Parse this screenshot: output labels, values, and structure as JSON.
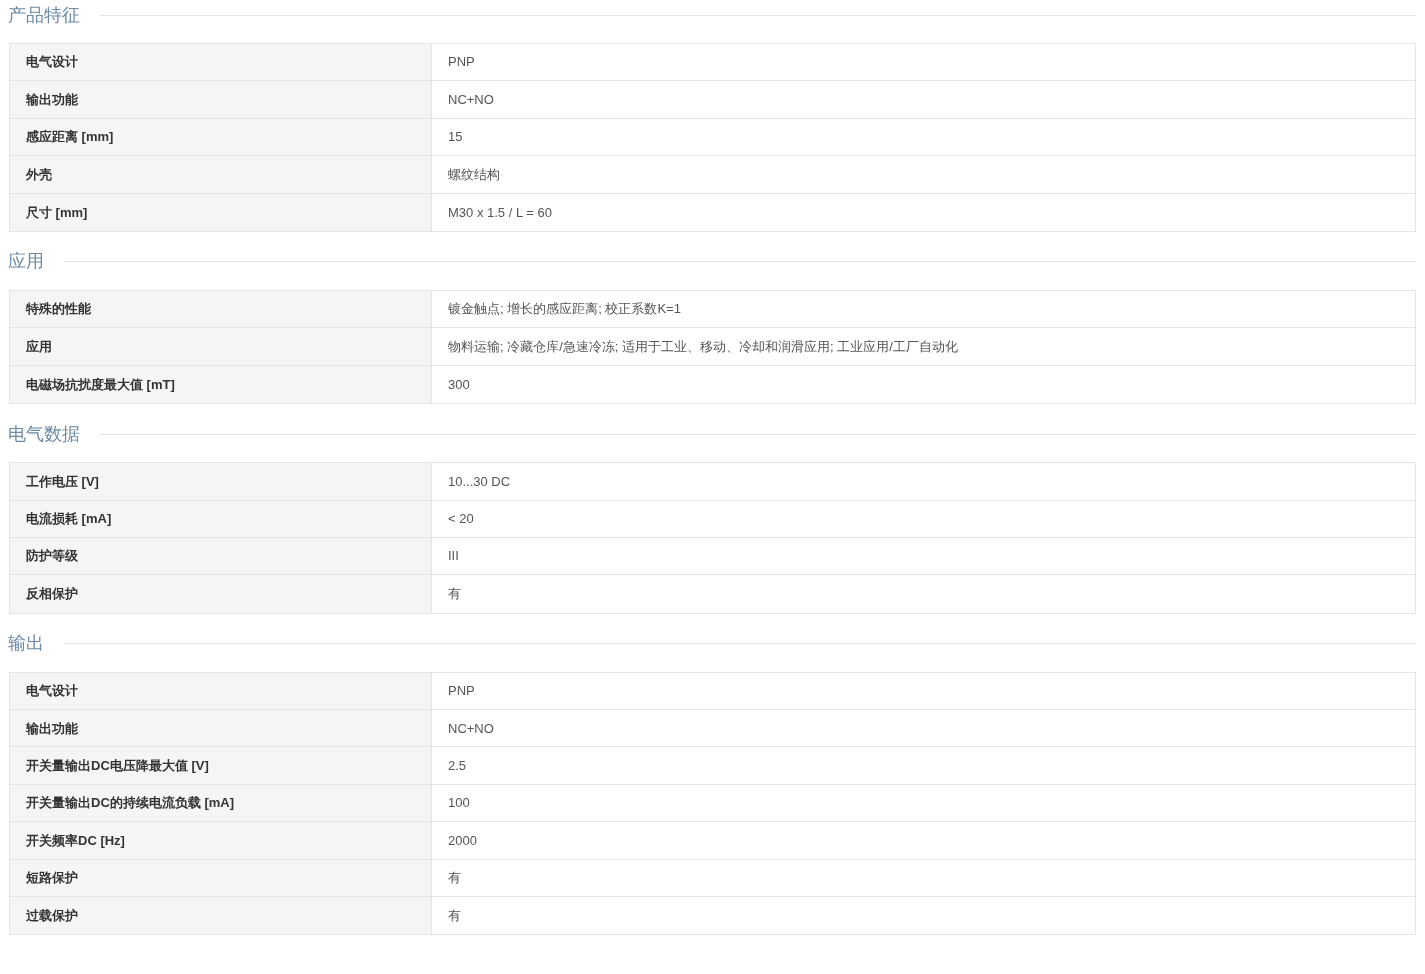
{
  "sections": [
    {
      "title": "产品特征",
      "rows": [
        {
          "label": "电气设计",
          "value": "PNP"
        },
        {
          "label": "输出功能",
          "value": "NC+NO"
        },
        {
          "label": "感应距离 [mm]",
          "value": "15"
        },
        {
          "label": "外壳",
          "value": "螺纹结构"
        },
        {
          "label": "尺寸 [mm]",
          "value": "M30 x 1.5 / L = 60"
        }
      ]
    },
    {
      "title": "应用",
      "rows": [
        {
          "label": "特殊的性能",
          "value": "镀金触点; 增长的感应距离; 校正系数K=1"
        },
        {
          "label": "应用",
          "value": "物料运输; 冷藏仓库/急速冷冻; 适用于工业、移动、冷却和润滑应用; 工业应用/工厂自动化"
        },
        {
          "label": "电磁场抗扰度最大值 [mT]",
          "value": "300"
        }
      ]
    },
    {
      "title": "电气数据",
      "rows": [
        {
          "label": "工作电压 [V]",
          "value": "10...30 DC"
        },
        {
          "label": "电流损耗 [mA]",
          "value": "< 20"
        },
        {
          "label": "防护等级",
          "value": "III"
        },
        {
          "label": "反相保护",
          "value": "有"
        }
      ]
    },
    {
      "title": "输出",
      "rows": [
        {
          "label": "电气设计",
          "value": "PNP"
        },
        {
          "label": "输出功能",
          "value": "NC+NO"
        },
        {
          "label": "开关量输出DC电压降最大值 [V]",
          "value": "2.5"
        },
        {
          "label": "开关量输出DC的持续电流负载 [mA]",
          "value": "100"
        },
        {
          "label": "开关频率DC [Hz]",
          "value": "2000"
        },
        {
          "label": "短路保护",
          "value": "有"
        },
        {
          "label": "过载保护",
          "value": "有"
        }
      ]
    }
  ]
}
